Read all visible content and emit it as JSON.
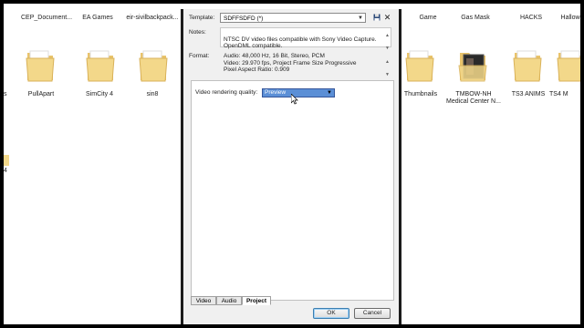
{
  "desktop": {
    "top_labels": [
      "CEP_Document...",
      "EA Games",
      "eir-sivilbackpack...",
      "Game",
      "Gas Mask",
      "HACKS",
      "Hallowe"
    ],
    "row_items": [
      {
        "label": "PullApart",
        "icon": "folder-icon"
      },
      {
        "label": "SimCity 4",
        "icon": "folder-icon"
      },
      {
        "label": "sin8",
        "icon": "folder-icon"
      },
      {
        "label": "Thumbnails",
        "icon": "folder-icon"
      },
      {
        "label": "TMBOW-NH\nMedical Center N...",
        "icon": "folder-image-icon"
      },
      {
        "label": "TS3 ANIMS",
        "icon": "folder-icon"
      },
      {
        "label": "TS4 M",
        "icon": "folder-icon"
      }
    ],
    "edge_left_labels": [
      "s",
      "4"
    ]
  },
  "dialog": {
    "template_label": "Template:",
    "template_value": "SDFFSDFD (*)",
    "notes_label": "Notes:",
    "notes_text": "NTSC DV video files compatible with Sony Video Capture.\nOpenDML compatible.",
    "format_label": "Format:",
    "format_lines": [
      "Audio: 48,000 Hz, 16 Bit, Stereo, PCM",
      "Video: 29.970 fps, Project Frame Size Progressive",
      "Pixel Aspect Ratio: 0.909"
    ],
    "quality_label": "Video rendering quality:",
    "quality_value": "Preview",
    "tabs": [
      "Video",
      "Audio",
      "Project"
    ],
    "active_tab": "Project",
    "ok_label": "OK",
    "cancel_label": "Cancel"
  },
  "colors": {
    "selection": "#5b8fd6",
    "folder": "#f3d88a",
    "dialog_bg": "#f0f0f0"
  }
}
